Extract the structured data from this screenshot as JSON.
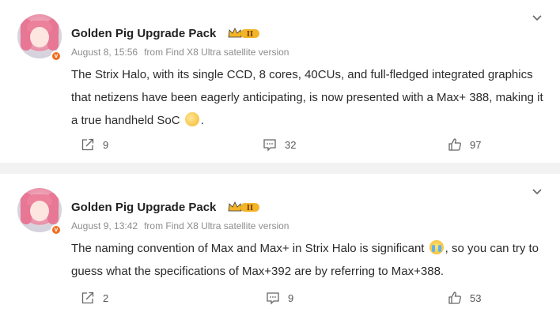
{
  "posts": [
    {
      "username": "Golden Pig Upgrade Pack",
      "level_badge": "II",
      "verified_badge": "v",
      "date": "August 8, 15:56",
      "source": "from Find X8 Ultra satellite version",
      "text_before_emoji": "The Strix Halo, with its single CCD, 8 cores, 40CUs, and full-fledged integrated graphics that netizens have been eagerly anticipating, is now presented with a Max+ 388, making it a true handheld SoC ",
      "text_after_emoji": ".",
      "emoji": "clapping-hand-emoji",
      "reposts": "9",
      "comments": "32",
      "likes": "97"
    },
    {
      "username": "Golden Pig Upgrade Pack",
      "level_badge": "II",
      "verified_badge": "v",
      "date": "August 9, 13:42",
      "source": "from Find X8 Ultra satellite version",
      "text_before_emoji": "The naming convention of Max and Max+ in Strix Halo is significant ",
      "text_after_emoji": ", so you can try to guess what the specifications of Max+392 are by referring to Max+388.",
      "emoji": "crying-face-emoji",
      "reposts": "2",
      "comments": "9",
      "likes": "53"
    }
  ],
  "colors": {
    "background": "#f2f2f2",
    "card": "#ffffff",
    "verified": "#f26d20",
    "crown": "#f2b428"
  }
}
